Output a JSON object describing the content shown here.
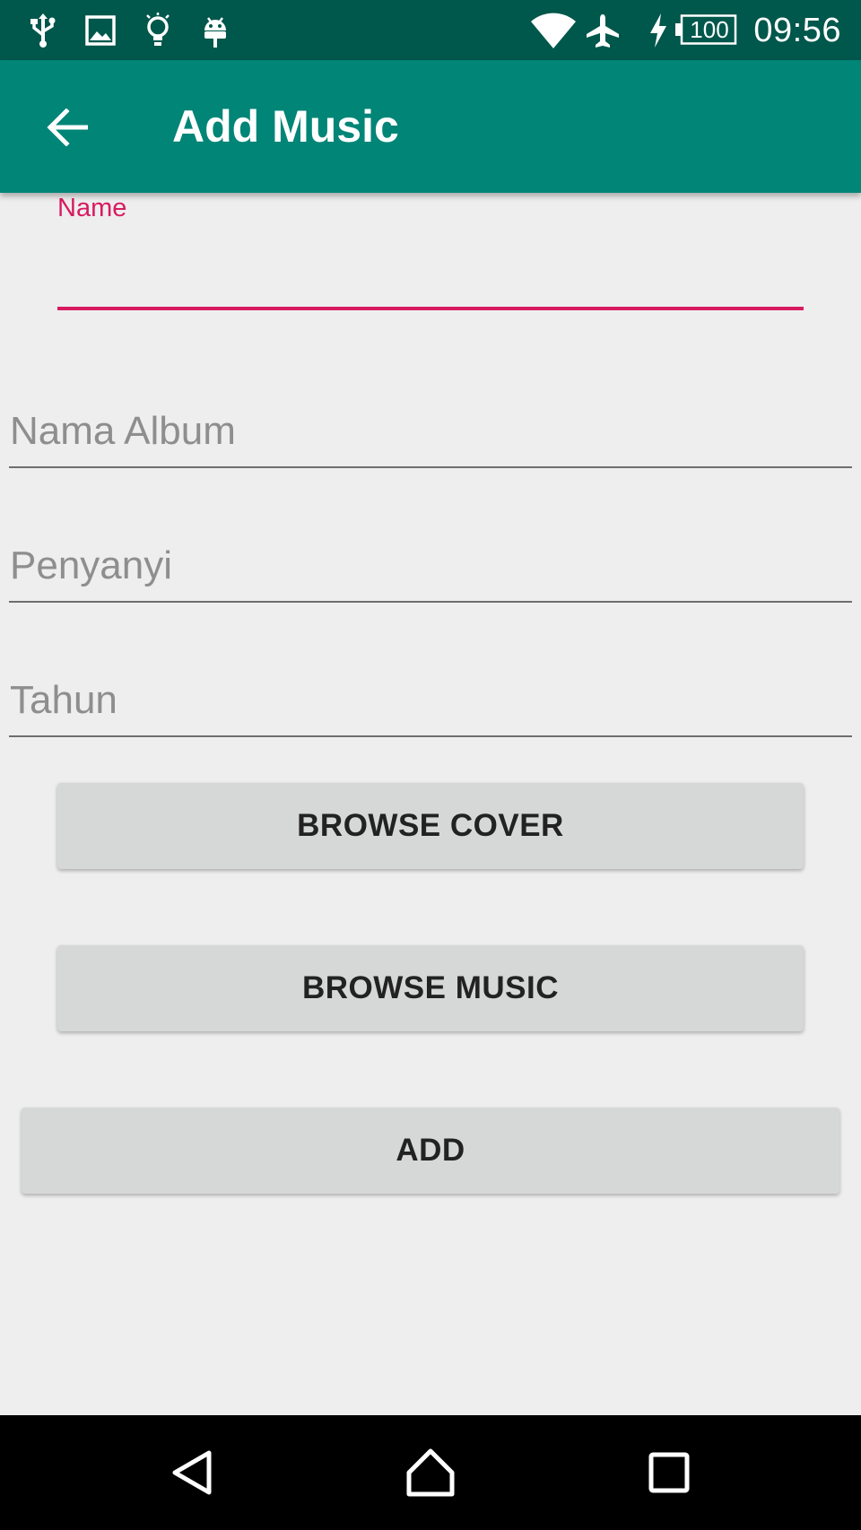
{
  "status_bar": {
    "icons": [
      "usb-icon",
      "image-icon",
      "lightbulb-icon",
      "android-icon",
      "wifi-icon",
      "airplane-icon",
      "charging-icon"
    ],
    "battery": "100",
    "time": "09:56"
  },
  "app_bar": {
    "title": "Add Music",
    "back_icon": "arrow-back-icon"
  },
  "form": {
    "name_label": "Name",
    "name_value": "",
    "album_placeholder": "Nama Album",
    "singer_placeholder": "Penyanyi",
    "year_placeholder": "Tahun"
  },
  "buttons": {
    "browse_cover": "BROWSE COVER",
    "browse_music": "BROWSE MUSIC",
    "add": "ADD"
  },
  "nav_bar": {
    "icons": [
      "back-triangle-icon",
      "home-icon",
      "recents-icon"
    ]
  },
  "colors": {
    "status_bar": "#00574b",
    "app_bar": "#008577",
    "accent": "#d81b60",
    "background": "#eeeeee",
    "button": "#d6d7d7"
  }
}
